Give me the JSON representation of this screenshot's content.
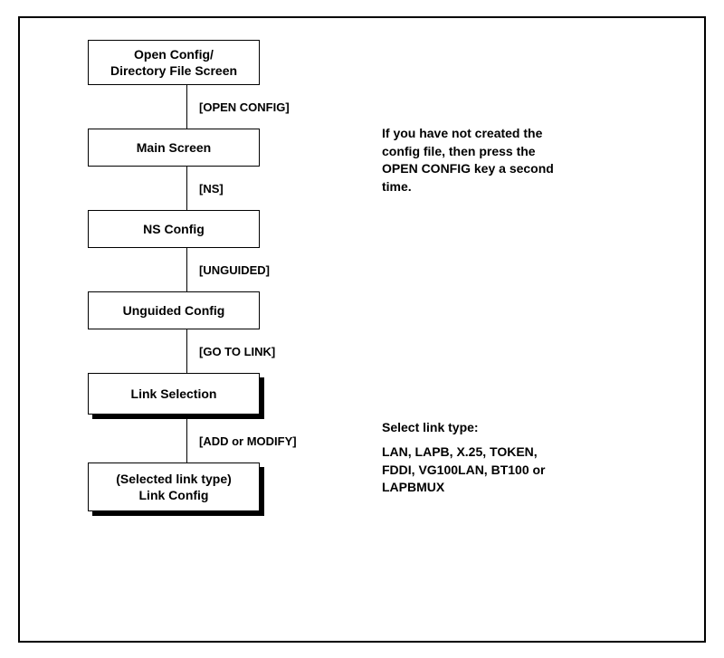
{
  "boxes": {
    "b1": "Open Config/\nDirectory File Screen",
    "b2": "Main Screen",
    "b3": "NS Config",
    "b4": "Unguided Config",
    "b5": "Link Selection",
    "b6": "(Selected link type)\nLink Config"
  },
  "labels": {
    "l1": "[OPEN CONFIG]",
    "l2": "[NS]",
    "l3": "[UNGUIDED]",
    "l4": "[GO TO LINK]",
    "l5": "[ADD or MODIFY]"
  },
  "sideText": {
    "note1": "If you have not created the\nconfig file, then press the\nOPEN CONFIG key a second\ntime.",
    "note2_title": "Select link type:",
    "note2_body": "LAN, LAPB, X.25, TOKEN,\nFDDI, VG100LAN, BT100 or\nLAPBMUX"
  }
}
